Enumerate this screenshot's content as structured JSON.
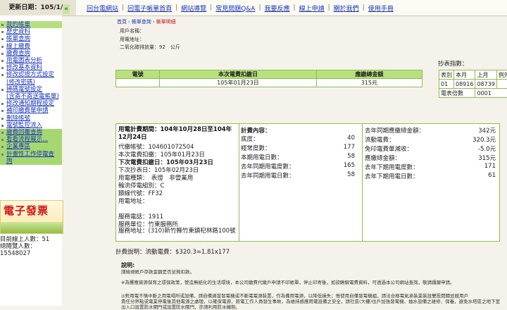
{
  "header": {
    "update_date_label": "更新日期：105/1/5",
    "nav": [
      "回台電網站",
      "回電子帳單首頁",
      "網站導覽",
      "常見問題Q&A",
      "我要反應",
      "線上申請",
      "關於我們",
      "使用手冊"
    ]
  },
  "sidebar": {
    "items": [
      {
        "label": "我的帳單"
      },
      {
        "label": "歷史資料"
      },
      {
        "label": "帳單查詢"
      },
      {
        "label": "線上繳費"
      },
      {
        "label": "繳費查詢"
      },
      {
        "label": "用電圖表分析"
      },
      {
        "label": "修改基本資料"
      },
      {
        "label": "修改認證方式設定"
      },
      {
        "label": "(修改密碼)"
      },
      {
        "label": "掃碼電號設定"
      },
      {
        "label": "(含寄不寄送電帳單)"
      },
      {
        "label": "修改通知期程設定"
      },
      {
        "label": "補印繳費單申請"
      },
      {
        "label": "刪除帳號"
      },
      {
        "label": "電號監控流入"
      },
      {
        "label": "繳費回覆查詢"
      },
      {
        "label": "看看流程展示..."
      },
      {
        "label": "企業專區"
      },
      {
        "label": "計畫性工作停電查"
      },
      {
        "label": "詢"
      }
    ],
    "banner_text": "電子發票",
    "online_users": "目前線上人數：51",
    "total_visitors_label": "總閱覽人數：",
    "total_visitors": "15548027",
    "collapse_label": "«"
  },
  "breadcrumb": {
    "home": "首頁",
    "bill_query": "帳單查詢",
    "current": "帳單明細"
  },
  "customer": {
    "name_label": "用戶名稱：",
    "address_label": "用電地址：",
    "co2_label": "二氧化碳排放量：92　公斤"
  },
  "bill": {
    "headers": [
      "電號",
      "本次電費扣繳日",
      "應繳總金額"
    ],
    "row": [
      "",
      "105年01月23日",
      "315元"
    ]
  },
  "meter": {
    "title": "抄表指數：",
    "headers": [
      "表別",
      "本月",
      "上月",
      "例外"
    ],
    "row1": [
      "01",
      "08916",
      "08739",
      ""
    ],
    "row2_label": "電表倍數",
    "row2_value": "0001"
  },
  "detail": {
    "period": "用電計費期間：104年10月28日至104年12月24日",
    "agent_account": "代繳帳號：104601072504",
    "this_deduct": "本次電費扣繳：105年01月23日",
    "next_deduct": "下次電費扣繳日：105年03月23日",
    "next_read": "下次抄表日：105年02月23日",
    "power_type": "用電種類：　表燈　非營業用",
    "outage_group": "輪流停電組別：C",
    "feeder": "饋線代號：FF32",
    "use_address": "用電地址：",
    "service_no": "服務電話：1911",
    "service_unit": "服務單位：竹東服務所",
    "service_address": "服務地址：(310)新竹縣竹東鎮杞林路100號",
    "content_title": "計費內容：",
    "content": [
      {
        "label": "底度：",
        "value": "40"
      },
      {
        "label": "經常度數：",
        "value": "177"
      },
      {
        "label": "本期用電日數：",
        "value": "58"
      },
      {
        "label": "去年同期用電度數：",
        "value": "165"
      },
      {
        "label": "去年同期用電日數：",
        "value": "58"
      }
    ],
    "amounts": [
      {
        "label": "去年同期應繳總金額：",
        "value": "342元"
      },
      {
        "label": "流動電費：",
        "value": "320.3元"
      },
      {
        "label": "免印電費單減收：",
        "value": "-5.0元"
      },
      {
        "label": "應繳總金額：",
        "value": "315元"
      },
      {
        "label": "去年下期用電度數：",
        "value": "171"
      },
      {
        "label": "去年下期用電日數：",
        "value": "61"
      }
    ]
  },
  "formula": "計費說明：流動電費：$320.3=1.81x177",
  "notes": {
    "title": "說明:",
    "lines": [
      "請檢視帳戶存款金額是否足夠扣款。",
      "※為響應資源保育之環保政策，營造無紙化的生活環境，本公司繳費代繳戶申請不印帳單，停止印寄後，如欲瞭解電費資料，可透過本公司網站查詢，敬請踴躍申請。",
      "◎對用電不慎中斷之用電場所或設備，請自備適當發電機或不斷電電源裝置，作為備用電源，以降低損失；惟使用自備發電機組，請洽合格電氣承裝業裝設雙投開關並經用戶",
      "責任分界點或電業停電後其他電源之處理，以確保電源，將電工作人員發生事故，為維持感應用電設備之安全，請社區(大樓)住戶加強發電機、抽水設備之維修、保養，避免水塔區之地下室出入口設置防水閘門或設置防水閘門，亦請利用防水機制。"
    ]
  }
}
